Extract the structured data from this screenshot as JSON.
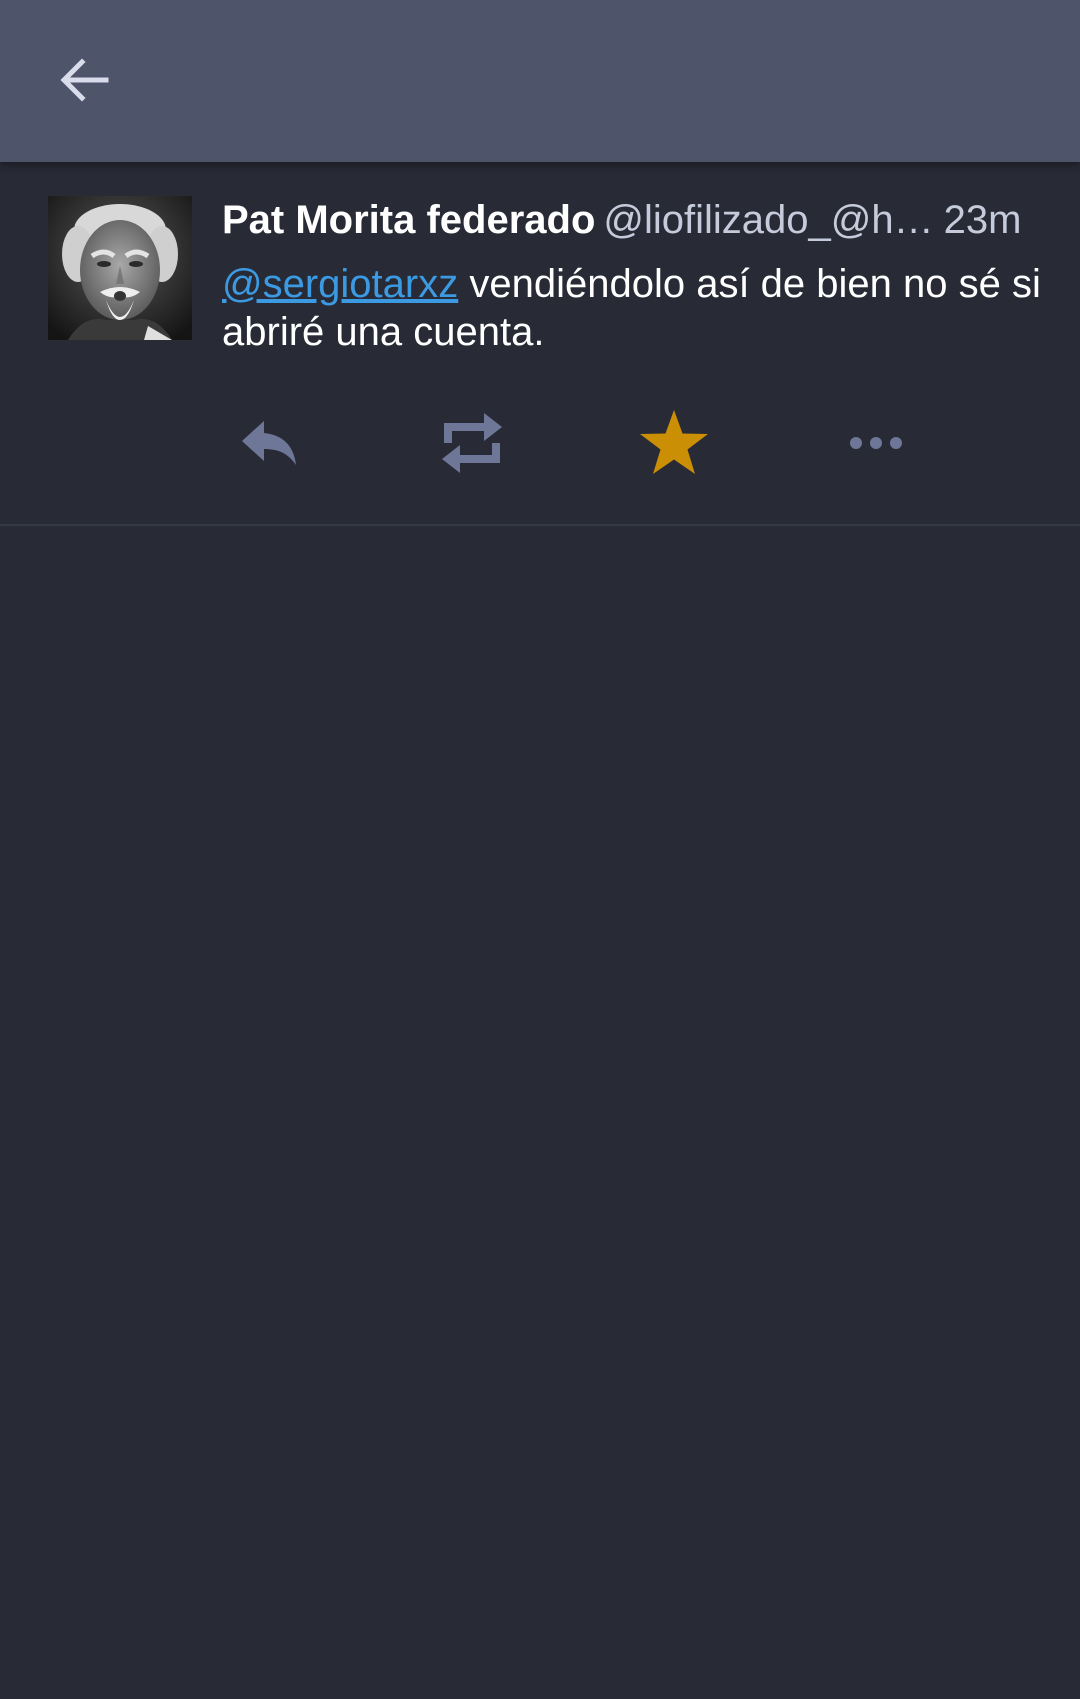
{
  "toolbar": {
    "back_icon": "arrow-left-icon"
  },
  "status": {
    "avatar_icon": "profile-photo",
    "display_name": "Pat Morita federado",
    "handle": "@liofilizado_@h…",
    "time": "23m",
    "mention": "@sergiotarxz",
    "text": " vendiéndolo así de bien no sé si abriré una cuenta.",
    "actions": [
      {
        "name": "reply",
        "icon": "reply-icon"
      },
      {
        "name": "boost",
        "icon": "retweet-icon"
      },
      {
        "name": "favourite",
        "icon": "star-icon",
        "active": true
      },
      {
        "name": "more",
        "icon": "more-icon"
      }
    ]
  },
  "colors": {
    "toolbar_bg": "#4e5469",
    "page_bg": "#282b36",
    "mention": "#3b9ae1",
    "action_icon": "#6e7797",
    "favourite_active": "#ca8f04"
  }
}
